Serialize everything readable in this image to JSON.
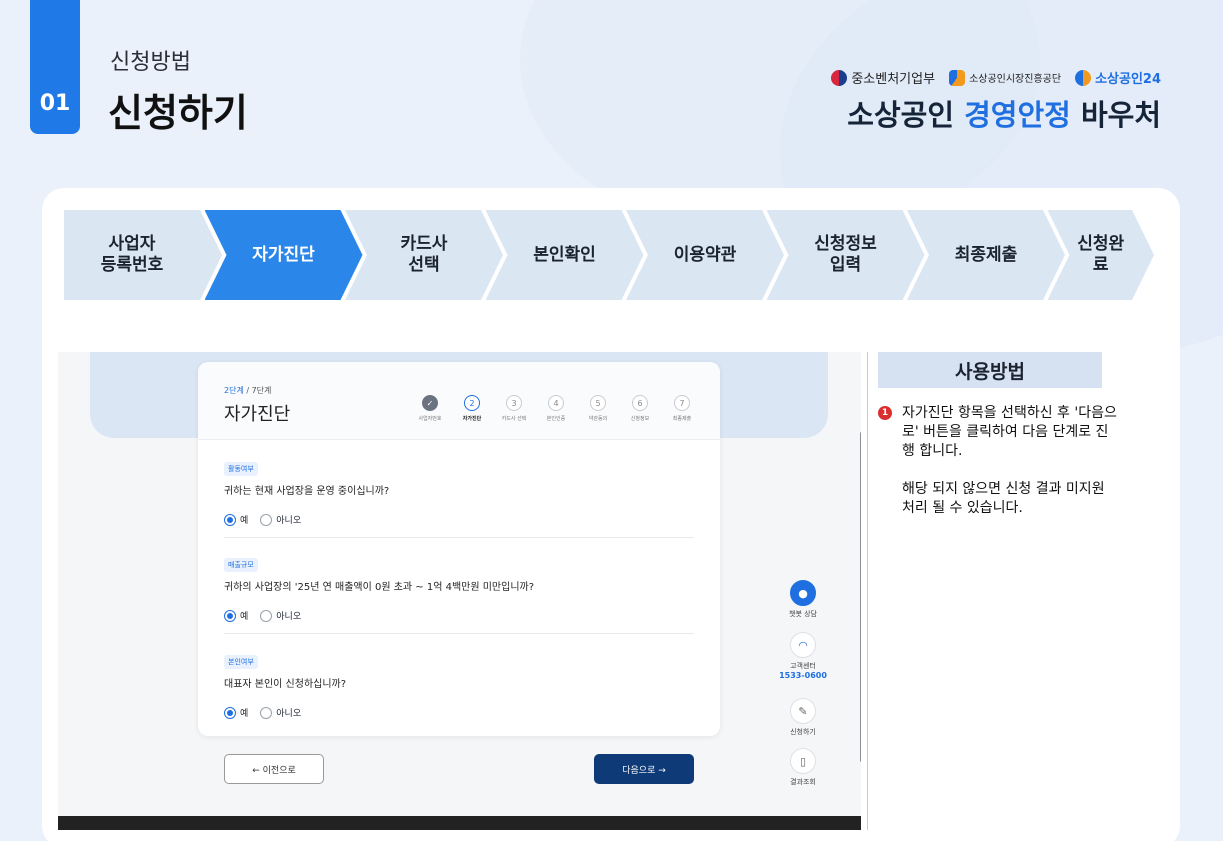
{
  "header": {
    "step_number": "01",
    "subtitle": "신청방법",
    "title": "신청하기",
    "logos": [
      "중소벤처기업부",
      "소상공인시장진흥공단",
      "소상공인24"
    ],
    "brand_prefix": "소상공인 ",
    "brand_highlight": "경영안정",
    "brand_suffix": " 바우처"
  },
  "steps": [
    "사업자\n등록번호",
    "자가진단",
    "카드사\n선택",
    "본인확인",
    "이용약관",
    "신청정보\n입력",
    "최종제출",
    "신청완료"
  ],
  "active_step": 1,
  "screen": {
    "page_indicator_current": "2단계",
    "page_indicator_total": " / 7단계",
    "page_title": "자가진단",
    "mini_steps": [
      "사업자번호",
      "자가진단",
      "카드사 선택",
      "본인인증",
      "약관동의",
      "신청정보",
      "최종제출"
    ],
    "questions": [
      {
        "tag": "활동여부",
        "text": "귀하는 현재 사업장을 운영 중이십니까?",
        "yes": "예",
        "no": "아니오"
      },
      {
        "tag": "매출규모",
        "text": "귀하의 사업장의 '25년 연 매출액이 0원 초과 ~ 1억 4백만원 미만입니까?",
        "yes": "예",
        "no": "아니오"
      },
      {
        "tag": "본인여부",
        "text": "대표자 본인이 신청하십니까?",
        "yes": "예",
        "no": "아니오"
      }
    ],
    "prev_button": "← 이전으로",
    "next_button": "다음으로 →",
    "side": {
      "chatbot": "챗봇 상담",
      "customer_center": "고객센터",
      "phone": "1533-0600",
      "apply": "신청하기",
      "result": "결과조회"
    }
  },
  "usage": {
    "title": "사용방법",
    "number": "1",
    "text1": "자가진단 항목을 선택하신 후 '다음으로' 버튼을 클릭하여 다음 단계로 진행 합니다.",
    "text2": "해당 되지 않으면 신청 결과 미지원 처리 될 수 있습니다."
  }
}
